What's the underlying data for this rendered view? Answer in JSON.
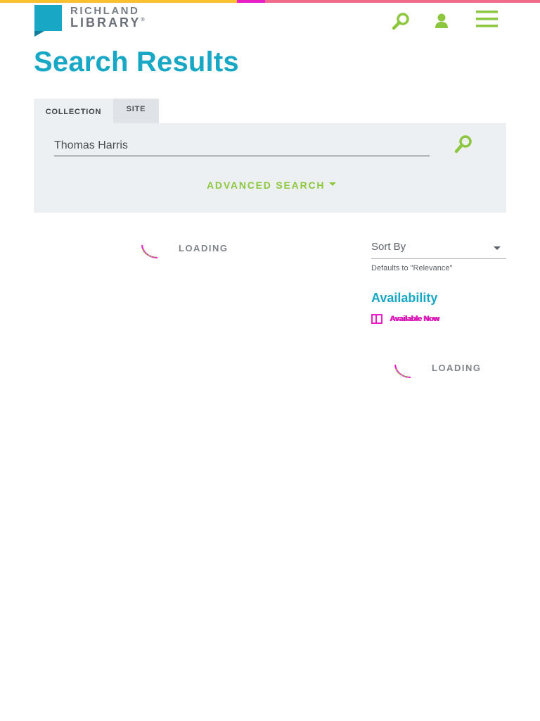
{
  "header": {
    "logo_line1": "RICHLAND",
    "logo_line2": "LIBRARY",
    "logo_mark": "®",
    "icons": [
      "search-icon",
      "user-icon",
      "menu-icon"
    ]
  },
  "page_title": "Search Results",
  "tabs": [
    {
      "label": "COLLECTION",
      "active": true
    },
    {
      "label": "SITE",
      "active": false
    }
  ],
  "search": {
    "value": "Thomas Harris",
    "submit_icon": "search-icon"
  },
  "advanced_search_label": "ADVANCED SEARCH",
  "results": {
    "loading_text": "LOADING"
  },
  "sidebar": {
    "sort_label": "Sort By",
    "sort_hint": "Defaults to \"Relevance\"",
    "availability_title": "Availability",
    "availability_option": "Available Now",
    "loading_text": "LOADING"
  },
  "colors": {
    "accent_blue": "#19a7c6",
    "accent_green": "#8dc63f",
    "accent_magenta": "#e91ec4",
    "panel_bg": "#edf0f2",
    "top_bar": [
      "#fbc02d",
      "#e91ec4",
      "#f06b8a"
    ]
  }
}
